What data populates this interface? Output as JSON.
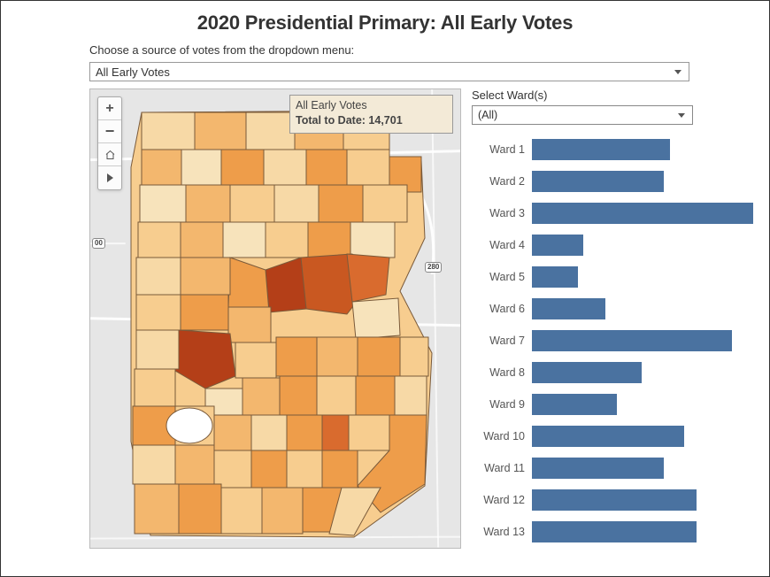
{
  "title": "2020 Presidential Primary: All Early Votes",
  "source_prompt": "Choose a source of votes from the dropdown menu:",
  "source_dropdown": {
    "selected": "All Early Votes"
  },
  "info_box": {
    "line1": "All Early Votes",
    "line2_label": "Total to Date",
    "line2_value": "14,701"
  },
  "shields": {
    "s1": "00",
    "s2": "280"
  },
  "right": {
    "select_label": "Select Ward(s)",
    "ward_dropdown": {
      "selected": "(All)"
    }
  },
  "chart_data": {
    "type": "bar",
    "title": "",
    "xlabel": "",
    "ylabel": "",
    "ylim": [
      0,
      1860
    ],
    "categories": [
      "Ward 1",
      "Ward 2",
      "Ward 3",
      "Ward 4",
      "Ward 5",
      "Ward 6",
      "Ward 7",
      "Ward 8",
      "Ward 9",
      "Ward 10",
      "Ward 11",
      "Ward 12",
      "Ward 13"
    ],
    "values": [
      1130,
      1080,
      1820,
      420,
      380,
      600,
      1640,
      900,
      700,
      1250,
      1080,
      1350,
      1350
    ]
  },
  "map_controls": {
    "zoom_in": "+",
    "zoom_out": "−"
  }
}
